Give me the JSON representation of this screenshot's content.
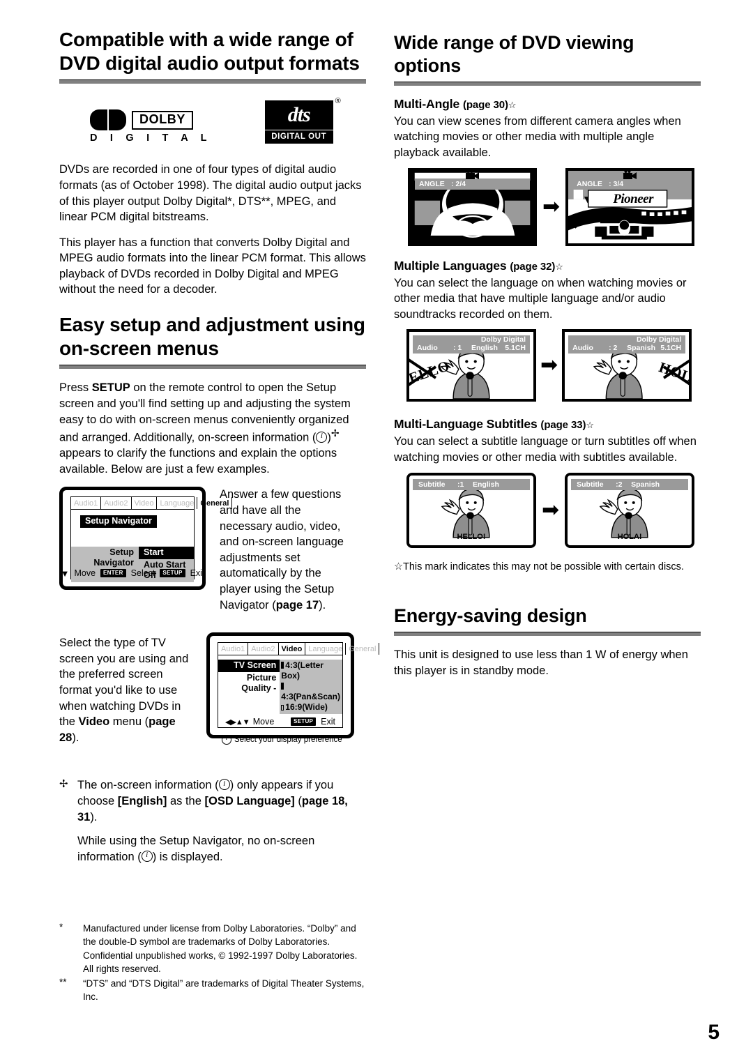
{
  "page": {
    "number": "5"
  },
  "left_column": {
    "heading1": {
      "line1": "Compatible with a wide range of",
      "line2": "DVD digital audio output formats"
    },
    "logos": {
      "dolby": {
        "word": "DOLBY",
        "sub": "D I G I T A L"
      },
      "dts": {
        "word": "dts",
        "registered": "®",
        "sub": "DIGITAL OUT"
      }
    },
    "paragraphs": [
      "DVDs are recorded in one of four types of digital audio formats (as of October 1998). The digital audio output jacks of this player output Dolby Digital*, DTS**, MPEG, and linear PCM digital bitstreams.",
      "This player has a function that converts Dolby Digital and MPEG audio formats into the linear PCM format. This allows playback of DVDs recorded in Dolby Digital and MPEG without the need for a decoder."
    ],
    "heading2": {
      "line1": "Easy setup and adjustment using",
      "line2": "on-screen menus"
    },
    "setup_paragraph": {
      "p1": "Press ",
      "setup_bold": "SETUP",
      "p2": " on the remote control to open the Setup screen and you'll find setting up and adjusting the system easy to do with on-screen menus conveniently organized and arranged. Additionally, on-screen information (",
      "p3": ")",
      "asterisk": "✢",
      "p4": " appears to clarify the functions and explain the options available. Below are just a few examples."
    },
    "osd_general": {
      "tabs": [
        "Audio1",
        "Audio2",
        "Video",
        "Language",
        "General"
      ],
      "active_tab": "General",
      "title": "Setup Navigator",
      "row_label": "Setup Navigator",
      "option_selected": "Start",
      "option_other": "Auto Start Off",
      "footer": {
        "move": "Move",
        "enter_key": "ENTER",
        "select": "Select",
        "setup_key": "SETUP",
        "exit": "Exit"
      }
    },
    "osd_general_caption": {
      "text": "Answer a few questions and have all the necessary audio, video, and on-screen language adjustments set automatically by the player using the Setup Navigator (",
      "page_ref": "page 17",
      "tail": ")."
    },
    "osd_video_caption": {
      "t1": "Select the type of TV screen you are using and the preferred screen format you'd like to use when watching DVDs in the ",
      "video_bold": "Video",
      "t2": " menu (",
      "page_ref": "page 28",
      "tail": ")."
    },
    "osd_video": {
      "tabs": [
        "Audio1",
        "Audio2",
        "Video",
        "Language",
        "General"
      ],
      "active_tab": "Video",
      "row1_label": "TV Screen",
      "row2_label": "Picture Quality -",
      "options": [
        "4:3(Letter Box)",
        "4:3(Pan&Scan)",
        "16:9(Wide)"
      ],
      "info_line": "Select your display preference",
      "footer": {
        "move": "Move",
        "setup_key": "SETUP",
        "exit": "Exit"
      }
    },
    "note": {
      "mark": "✢",
      "p1": "The on-screen information (",
      "p2": ") only appears if you choose ",
      "english_bold": "[English]",
      "p3": " as the ",
      "osd_bold": "[OSD Language]",
      "p4": " (",
      "page_ref": "page 18, 31",
      "p5": ").",
      "second": {
        "a": "While using the Setup Navigator, no on-screen information (",
        "b": ") is displayed."
      }
    },
    "footnotes": [
      {
        "mark": "*",
        "text": "Manufactured under license from Dolby Laboratories. “Dolby” and the double-D symbol are trademarks of Dolby Laboratories. Confidential unpublished works, © 1992-1997 Dolby Laboratories. All rights reserved."
      },
      {
        "mark": "**",
        "text": "“DTS” and “DTS Digital” are trademarks of Digital Theater Systems, Inc."
      }
    ]
  },
  "right_column": {
    "heading1": "Wide range of DVD viewing options",
    "multi_angle": {
      "title": "Multi-Angle",
      "page_ref": "(page 30)",
      "star": "☆",
      "body": "You can view scenes from different camera angles when watching movies or other media with multiple angle playback available.",
      "tv_left": {
        "label": "ANGLE",
        "value": ": 2/4"
      },
      "tv_right": {
        "label": "ANGLE",
        "value": ": 3/4",
        "brand": "Pioneer"
      }
    },
    "multiple_languages": {
      "title": "Multiple Languages",
      "page_ref": "(page 32)",
      "star": "☆",
      "body": "You can select the language on when watching movies or other media that have multiple language and/or audio soundtracks recorded on them.",
      "tv_left": {
        "label": "Audio",
        "num": ": 1",
        "lang": "English",
        "format_line1": "Dolby Digital",
        "format_line2": "5.1CH",
        "word": "HELLO"
      },
      "tv_right": {
        "label": "Audio",
        "num": ": 2",
        "lang": "Spanish",
        "format_line1": "Dolby Digital",
        "format_line2": "5.1CH",
        "word": "HOLA"
      }
    },
    "subtitles": {
      "title": "Multi-Language Subtitles",
      "page_ref": "(page 33)",
      "star": "☆",
      "body": "You can select a subtitle language or turn subtitles off when watching movies or other media with subtitles available.",
      "tv_left": {
        "label": "Subtitle",
        "num": ":1",
        "lang": "English",
        "caption": "HELLO!"
      },
      "tv_right": {
        "label": "Subtitle",
        "num": ":2",
        "lang": "Spanish",
        "caption": "HOLA!"
      }
    },
    "star_note": "☆This mark indicates this may not be possible with certain discs.",
    "energy": {
      "heading": "Energy-saving design",
      "body": "This unit is designed to use less than 1 W of energy when this player is in standby mode."
    }
  }
}
